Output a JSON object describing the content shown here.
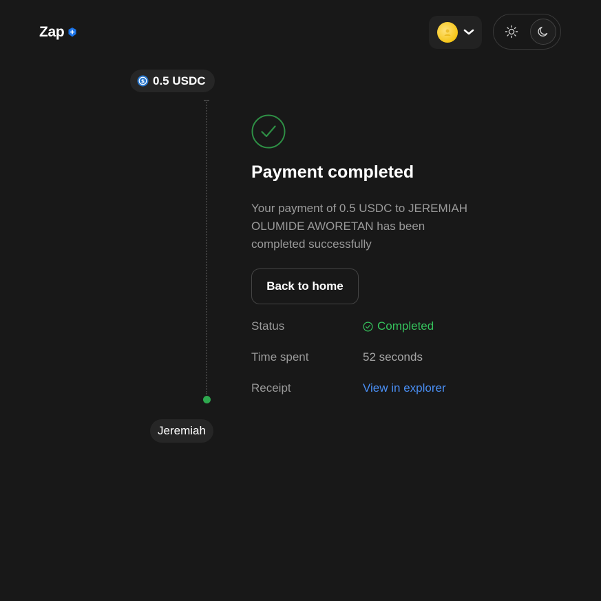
{
  "header": {
    "logo_text": "Zap",
    "logo_badge_color": "#1a73e8",
    "avatar_icon": "user-avatar",
    "menu_icon": "chevron-down-icon",
    "theme": {
      "light_icon": "sun-icon",
      "dark_icon": "moon-icon",
      "active": "dark"
    }
  },
  "timeline": {
    "amount_label": "0.5 USDC",
    "token_icon": "usdc-icon",
    "recipient_label": "Jeremiah",
    "dot_color": "#2ea94f"
  },
  "result": {
    "icon": "check-circle-icon",
    "title": "Payment completed",
    "message": "Your payment of 0.5 USDC to JEREMIAH OLUMIDE AWORETAN has been completed successfully",
    "back_button_label": "Back to home"
  },
  "details": {
    "status_label": "Status",
    "status_value": "Completed",
    "status_color": "#35c25c",
    "time_label": "Time spent",
    "time_value": "52 seconds",
    "receipt_label": "Receipt",
    "receipt_link_text": "View in explorer",
    "link_color": "#4a8ff5"
  }
}
